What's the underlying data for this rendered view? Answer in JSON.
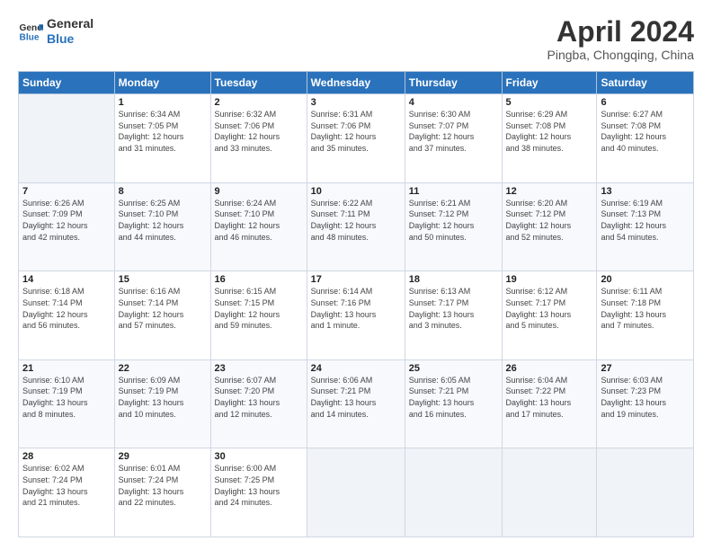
{
  "header": {
    "logo_line1": "General",
    "logo_line2": "Blue",
    "month_title": "April 2024",
    "location": "Pingba, Chongqing, China"
  },
  "weekdays": [
    "Sunday",
    "Monday",
    "Tuesday",
    "Wednesday",
    "Thursday",
    "Friday",
    "Saturday"
  ],
  "weeks": [
    [
      {
        "day": "",
        "info": ""
      },
      {
        "day": "1",
        "info": "Sunrise: 6:34 AM\nSunset: 7:05 PM\nDaylight: 12 hours\nand 31 minutes."
      },
      {
        "day": "2",
        "info": "Sunrise: 6:32 AM\nSunset: 7:06 PM\nDaylight: 12 hours\nand 33 minutes."
      },
      {
        "day": "3",
        "info": "Sunrise: 6:31 AM\nSunset: 7:06 PM\nDaylight: 12 hours\nand 35 minutes."
      },
      {
        "day": "4",
        "info": "Sunrise: 6:30 AM\nSunset: 7:07 PM\nDaylight: 12 hours\nand 37 minutes."
      },
      {
        "day": "5",
        "info": "Sunrise: 6:29 AM\nSunset: 7:08 PM\nDaylight: 12 hours\nand 38 minutes."
      },
      {
        "day": "6",
        "info": "Sunrise: 6:27 AM\nSunset: 7:08 PM\nDaylight: 12 hours\nand 40 minutes."
      }
    ],
    [
      {
        "day": "7",
        "info": "Sunrise: 6:26 AM\nSunset: 7:09 PM\nDaylight: 12 hours\nand 42 minutes."
      },
      {
        "day": "8",
        "info": "Sunrise: 6:25 AM\nSunset: 7:10 PM\nDaylight: 12 hours\nand 44 minutes."
      },
      {
        "day": "9",
        "info": "Sunrise: 6:24 AM\nSunset: 7:10 PM\nDaylight: 12 hours\nand 46 minutes."
      },
      {
        "day": "10",
        "info": "Sunrise: 6:22 AM\nSunset: 7:11 PM\nDaylight: 12 hours\nand 48 minutes."
      },
      {
        "day": "11",
        "info": "Sunrise: 6:21 AM\nSunset: 7:12 PM\nDaylight: 12 hours\nand 50 minutes."
      },
      {
        "day": "12",
        "info": "Sunrise: 6:20 AM\nSunset: 7:12 PM\nDaylight: 12 hours\nand 52 minutes."
      },
      {
        "day": "13",
        "info": "Sunrise: 6:19 AM\nSunset: 7:13 PM\nDaylight: 12 hours\nand 54 minutes."
      }
    ],
    [
      {
        "day": "14",
        "info": "Sunrise: 6:18 AM\nSunset: 7:14 PM\nDaylight: 12 hours\nand 56 minutes."
      },
      {
        "day": "15",
        "info": "Sunrise: 6:16 AM\nSunset: 7:14 PM\nDaylight: 12 hours\nand 57 minutes."
      },
      {
        "day": "16",
        "info": "Sunrise: 6:15 AM\nSunset: 7:15 PM\nDaylight: 12 hours\nand 59 minutes."
      },
      {
        "day": "17",
        "info": "Sunrise: 6:14 AM\nSunset: 7:16 PM\nDaylight: 13 hours\nand 1 minute."
      },
      {
        "day": "18",
        "info": "Sunrise: 6:13 AM\nSunset: 7:17 PM\nDaylight: 13 hours\nand 3 minutes."
      },
      {
        "day": "19",
        "info": "Sunrise: 6:12 AM\nSunset: 7:17 PM\nDaylight: 13 hours\nand 5 minutes."
      },
      {
        "day": "20",
        "info": "Sunrise: 6:11 AM\nSunset: 7:18 PM\nDaylight: 13 hours\nand 7 minutes."
      }
    ],
    [
      {
        "day": "21",
        "info": "Sunrise: 6:10 AM\nSunset: 7:19 PM\nDaylight: 13 hours\nand 8 minutes."
      },
      {
        "day": "22",
        "info": "Sunrise: 6:09 AM\nSunset: 7:19 PM\nDaylight: 13 hours\nand 10 minutes."
      },
      {
        "day": "23",
        "info": "Sunrise: 6:07 AM\nSunset: 7:20 PM\nDaylight: 13 hours\nand 12 minutes."
      },
      {
        "day": "24",
        "info": "Sunrise: 6:06 AM\nSunset: 7:21 PM\nDaylight: 13 hours\nand 14 minutes."
      },
      {
        "day": "25",
        "info": "Sunrise: 6:05 AM\nSunset: 7:21 PM\nDaylight: 13 hours\nand 16 minutes."
      },
      {
        "day": "26",
        "info": "Sunrise: 6:04 AM\nSunset: 7:22 PM\nDaylight: 13 hours\nand 17 minutes."
      },
      {
        "day": "27",
        "info": "Sunrise: 6:03 AM\nSunset: 7:23 PM\nDaylight: 13 hours\nand 19 minutes."
      }
    ],
    [
      {
        "day": "28",
        "info": "Sunrise: 6:02 AM\nSunset: 7:24 PM\nDaylight: 13 hours\nand 21 minutes."
      },
      {
        "day": "29",
        "info": "Sunrise: 6:01 AM\nSunset: 7:24 PM\nDaylight: 13 hours\nand 22 minutes."
      },
      {
        "day": "30",
        "info": "Sunrise: 6:00 AM\nSunset: 7:25 PM\nDaylight: 13 hours\nand 24 minutes."
      },
      {
        "day": "",
        "info": ""
      },
      {
        "day": "",
        "info": ""
      },
      {
        "day": "",
        "info": ""
      },
      {
        "day": "",
        "info": ""
      }
    ]
  ]
}
